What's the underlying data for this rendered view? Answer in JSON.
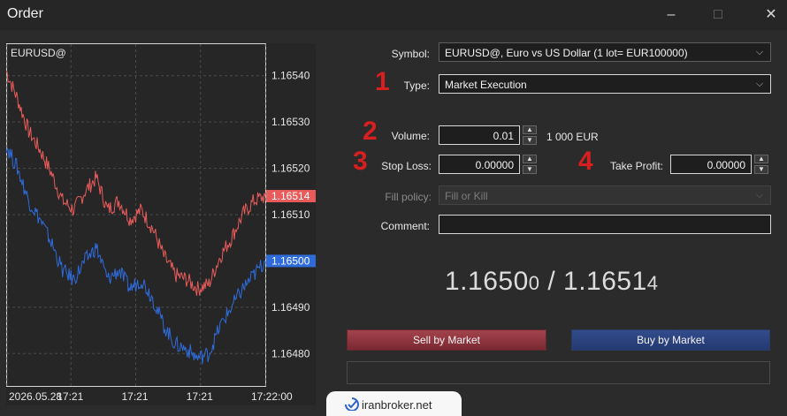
{
  "window": {
    "title": "Order",
    "minimize_icon": "–",
    "maximize_icon": "□",
    "close_icon": "✕"
  },
  "chart_data": {
    "type": "line",
    "title": "EURUSD@",
    "x_ticks": [
      "2026.05.28",
      "17:21",
      "17:21",
      "17:21",
      "17:22:00"
    ],
    "y_ticks": [
      "1.16540",
      "1.16530",
      "1.16520",
      "1.16510",
      "1.16490",
      "1.16480"
    ],
    "ylim": [
      1.16473,
      1.16547
    ],
    "series": [
      {
        "color": "#e95b5b",
        "values": [
          1.16541,
          1.16535,
          1.16528,
          1.16524,
          1.16519,
          1.16513,
          1.16511,
          1.16515,
          1.16518,
          1.16511,
          1.16513,
          1.16509,
          1.16511,
          1.16507,
          1.16501,
          1.16497,
          1.16496,
          1.16494,
          1.16495,
          1.16501,
          1.16505,
          1.1651,
          1.16513,
          1.16514
        ]
      },
      {
        "color": "#2f6bdb",
        "values": [
          1.16525,
          1.1652,
          1.16513,
          1.16509,
          1.16504,
          1.16498,
          1.16496,
          1.165,
          1.16503,
          1.16496,
          1.16498,
          1.16494,
          1.16496,
          1.16492,
          1.16486,
          1.16482,
          1.16481,
          1.16479,
          1.1648,
          1.16486,
          1.1649,
          1.16494,
          1.16497,
          1.165
        ]
      }
    ],
    "price_labels": [
      {
        "text": "1.16514",
        "color": "#e95b5b",
        "value": 1.16514
      },
      {
        "text": "1.16500",
        "color": "#2f6bdb",
        "value": 1.165
      }
    ]
  },
  "form": {
    "symbol_label": "Symbol:",
    "symbol_value": "EURUSD@, Euro vs US Dollar (1 lot= EUR100000)",
    "type_label": "Type:",
    "type_value": "Market Execution",
    "volume_label": "Volume:",
    "volume_value": "0.01",
    "volume_unit": "1 000 EUR",
    "stoploss_label": "Stop Loss:",
    "stoploss_value": "0.00000",
    "takeprofit_label": "Take Profit:",
    "takeprofit_value": "0.00000",
    "fill_label": "Fill policy:",
    "fill_value": "Fill or Kill",
    "comment_label": "Comment:",
    "comment_value": ""
  },
  "quote": {
    "bid_main": "1.1650",
    "bid_small": "0",
    "separator": " / ",
    "ask_main": "1.1651",
    "ask_small": "4"
  },
  "actions": {
    "sell_label": "Sell by Market",
    "buy_label": "Buy by Market"
  },
  "annotations": [
    "1",
    "2",
    "3",
    "4"
  ],
  "brand": {
    "text": "iranbroker.net"
  }
}
